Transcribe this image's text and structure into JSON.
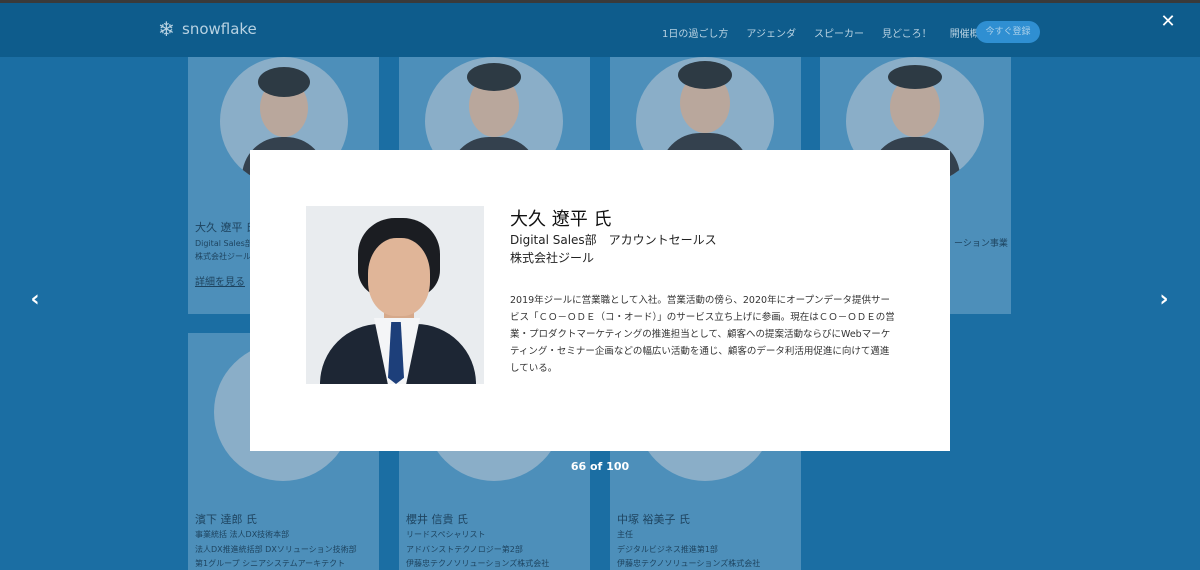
{
  "header": {
    "logo_text": "snowflake",
    "nav": [
      "1日の過ごし方",
      "アジェンダ",
      "スピーカー",
      "見どころ！",
      "開催概要"
    ],
    "cta": "今すぐ登録"
  },
  "background_cards": {
    "card1": {
      "name": "大久 遼平 氏",
      "line1": "Digital Sales部",
      "line2": "株式会社ジール",
      "link": "詳細を見る"
    },
    "card4": {
      "line1": "ーション事業"
    },
    "card5": {
      "name": "濱下 達郎 氏",
      "line1": "事業統括 法人DX技術本部",
      "line2": "法人DX推進統括部 DXソリューション技術部",
      "line3": "第1グループ シニアシステムアーキテクト"
    },
    "card6": {
      "name": "櫻井 信貴 氏",
      "line1": "リードスペシャリスト",
      "line2": "アドバンストテクノロジー第2部",
      "line3": "伊藤忠テクノソリューションズ株式会社"
    },
    "card7": {
      "name": "中塚 裕美子 氏",
      "line1": "主任",
      "line2": "デジタルビジネス推進第1部",
      "line3": "伊藤忠テクノソリューションズ株式会社"
    }
  },
  "modal": {
    "name": "大久 遼平 氏",
    "department": "Digital Sales部　アカウントセールス",
    "company": "株式会社ジール",
    "bio": "2019年ジールに営業職として入社。営業活動の傍ら、2020年にオープンデータ提供サービス「ＣＯ－ＯＤＥ（コ・オード）」のサービス立ち上げに参画。現在はＣＯ－ＯＤＥの営業・プロダクトマーケティングの推進担当として、顧客への提案活動ならびにWebマーケティング・セミナー企画などの幅広い活動を通じ、顧客のデータ利活用促進に向けて邁進している。"
  },
  "lightbox": {
    "counter": "66 of 100",
    "close_icon": "✕",
    "prev_icon": "‹",
    "next_icon": "›"
  }
}
